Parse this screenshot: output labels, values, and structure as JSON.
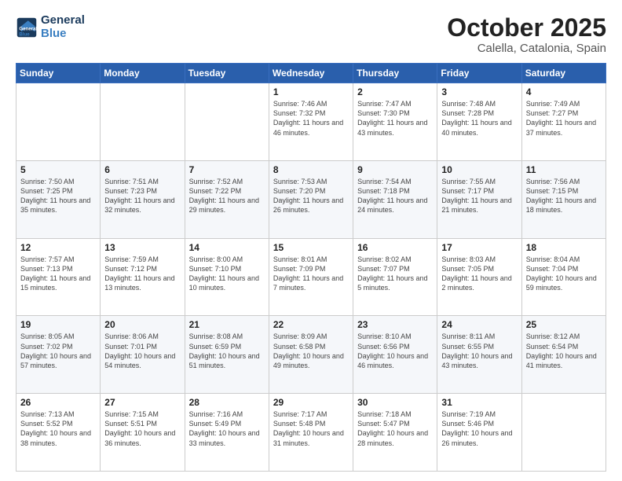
{
  "logo": {
    "text_general": "General",
    "text_blue": "Blue"
  },
  "title": "October 2025",
  "subtitle": "Calella, Catalonia, Spain",
  "days_header": [
    "Sunday",
    "Monday",
    "Tuesday",
    "Wednesday",
    "Thursday",
    "Friday",
    "Saturday"
  ],
  "weeks": [
    [
      {
        "day": "",
        "info": ""
      },
      {
        "day": "",
        "info": ""
      },
      {
        "day": "",
        "info": ""
      },
      {
        "day": "1",
        "info": "Sunrise: 7:46 AM\nSunset: 7:32 PM\nDaylight: 11 hours\nand 46 minutes."
      },
      {
        "day": "2",
        "info": "Sunrise: 7:47 AM\nSunset: 7:30 PM\nDaylight: 11 hours\nand 43 minutes."
      },
      {
        "day": "3",
        "info": "Sunrise: 7:48 AM\nSunset: 7:28 PM\nDaylight: 11 hours\nand 40 minutes."
      },
      {
        "day": "4",
        "info": "Sunrise: 7:49 AM\nSunset: 7:27 PM\nDaylight: 11 hours\nand 37 minutes."
      }
    ],
    [
      {
        "day": "5",
        "info": "Sunrise: 7:50 AM\nSunset: 7:25 PM\nDaylight: 11 hours\nand 35 minutes."
      },
      {
        "day": "6",
        "info": "Sunrise: 7:51 AM\nSunset: 7:23 PM\nDaylight: 11 hours\nand 32 minutes."
      },
      {
        "day": "7",
        "info": "Sunrise: 7:52 AM\nSunset: 7:22 PM\nDaylight: 11 hours\nand 29 minutes."
      },
      {
        "day": "8",
        "info": "Sunrise: 7:53 AM\nSunset: 7:20 PM\nDaylight: 11 hours\nand 26 minutes."
      },
      {
        "day": "9",
        "info": "Sunrise: 7:54 AM\nSunset: 7:18 PM\nDaylight: 11 hours\nand 24 minutes."
      },
      {
        "day": "10",
        "info": "Sunrise: 7:55 AM\nSunset: 7:17 PM\nDaylight: 11 hours\nand 21 minutes."
      },
      {
        "day": "11",
        "info": "Sunrise: 7:56 AM\nSunset: 7:15 PM\nDaylight: 11 hours\nand 18 minutes."
      }
    ],
    [
      {
        "day": "12",
        "info": "Sunrise: 7:57 AM\nSunset: 7:13 PM\nDaylight: 11 hours\nand 15 minutes."
      },
      {
        "day": "13",
        "info": "Sunrise: 7:59 AM\nSunset: 7:12 PM\nDaylight: 11 hours\nand 13 minutes."
      },
      {
        "day": "14",
        "info": "Sunrise: 8:00 AM\nSunset: 7:10 PM\nDaylight: 11 hours\nand 10 minutes."
      },
      {
        "day": "15",
        "info": "Sunrise: 8:01 AM\nSunset: 7:09 PM\nDaylight: 11 hours\nand 7 minutes."
      },
      {
        "day": "16",
        "info": "Sunrise: 8:02 AM\nSunset: 7:07 PM\nDaylight: 11 hours\nand 5 minutes."
      },
      {
        "day": "17",
        "info": "Sunrise: 8:03 AM\nSunset: 7:05 PM\nDaylight: 11 hours\nand 2 minutes."
      },
      {
        "day": "18",
        "info": "Sunrise: 8:04 AM\nSunset: 7:04 PM\nDaylight: 10 hours\nand 59 minutes."
      }
    ],
    [
      {
        "day": "19",
        "info": "Sunrise: 8:05 AM\nSunset: 7:02 PM\nDaylight: 10 hours\nand 57 minutes."
      },
      {
        "day": "20",
        "info": "Sunrise: 8:06 AM\nSunset: 7:01 PM\nDaylight: 10 hours\nand 54 minutes."
      },
      {
        "day": "21",
        "info": "Sunrise: 8:08 AM\nSunset: 6:59 PM\nDaylight: 10 hours\nand 51 minutes."
      },
      {
        "day": "22",
        "info": "Sunrise: 8:09 AM\nSunset: 6:58 PM\nDaylight: 10 hours\nand 49 minutes."
      },
      {
        "day": "23",
        "info": "Sunrise: 8:10 AM\nSunset: 6:56 PM\nDaylight: 10 hours\nand 46 minutes."
      },
      {
        "day": "24",
        "info": "Sunrise: 8:11 AM\nSunset: 6:55 PM\nDaylight: 10 hours\nand 43 minutes."
      },
      {
        "day": "25",
        "info": "Sunrise: 8:12 AM\nSunset: 6:54 PM\nDaylight: 10 hours\nand 41 minutes."
      }
    ],
    [
      {
        "day": "26",
        "info": "Sunrise: 7:13 AM\nSunset: 5:52 PM\nDaylight: 10 hours\nand 38 minutes."
      },
      {
        "day": "27",
        "info": "Sunrise: 7:15 AM\nSunset: 5:51 PM\nDaylight: 10 hours\nand 36 minutes."
      },
      {
        "day": "28",
        "info": "Sunrise: 7:16 AM\nSunset: 5:49 PM\nDaylight: 10 hours\nand 33 minutes."
      },
      {
        "day": "29",
        "info": "Sunrise: 7:17 AM\nSunset: 5:48 PM\nDaylight: 10 hours\nand 31 minutes."
      },
      {
        "day": "30",
        "info": "Sunrise: 7:18 AM\nSunset: 5:47 PM\nDaylight: 10 hours\nand 28 minutes."
      },
      {
        "day": "31",
        "info": "Sunrise: 7:19 AM\nSunset: 5:46 PM\nDaylight: 10 hours\nand 26 minutes."
      },
      {
        "day": "",
        "info": ""
      }
    ]
  ]
}
